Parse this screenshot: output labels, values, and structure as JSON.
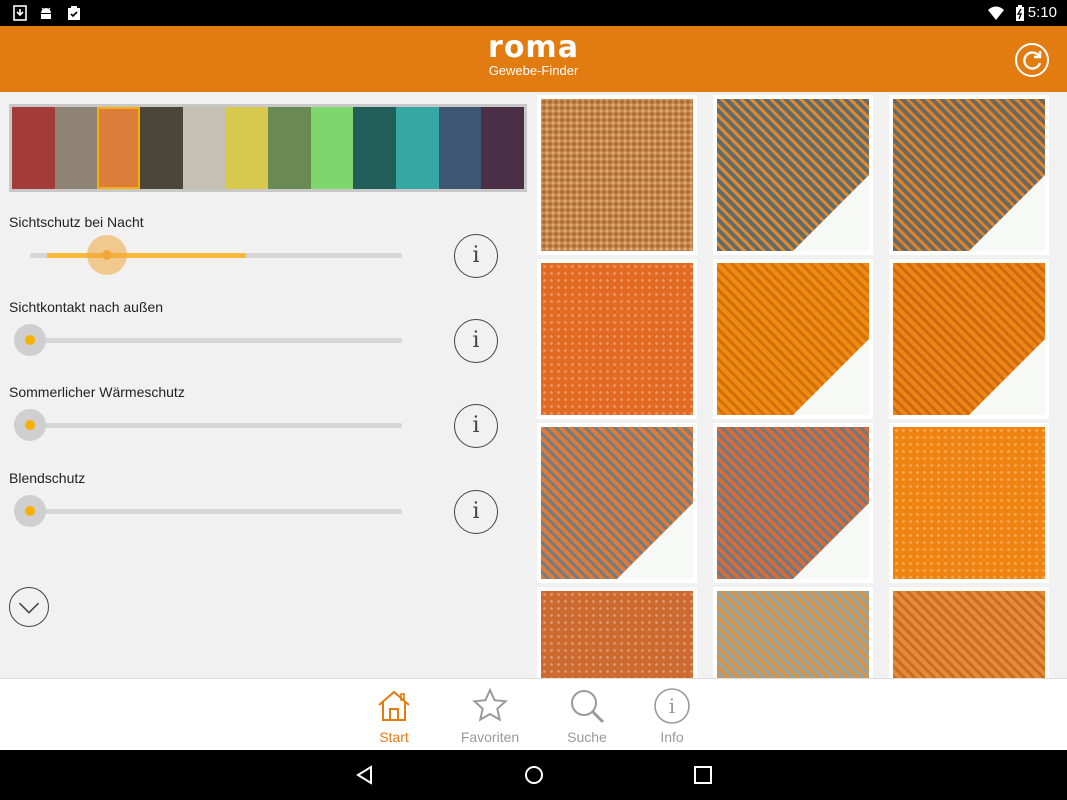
{
  "status_bar": {
    "time": "5:10",
    "left_icons": [
      "download-icon",
      "android-icon",
      "clipboard-check-icon"
    ],
    "right_icons": [
      "wifi-icon",
      "battery-charging-icon"
    ]
  },
  "app_bar": {
    "brand": "roma",
    "subtitle": "Gewebe-Finder",
    "refresh_icon": "refresh-icon",
    "background": "#e27c10"
  },
  "color_palette": [
    {
      "color": "#a23b3a"
    },
    {
      "color": "#8f8474"
    },
    {
      "color": "#dc7d3c",
      "selected": true
    },
    {
      "color": "#4a4638"
    },
    {
      "color": "#c4c1b2"
    },
    {
      "color": "#d6c94e"
    },
    {
      "color": "#6a8a53"
    },
    {
      "color": "#7fd66c"
    },
    {
      "color": "#215e5a"
    },
    {
      "color": "#35a8a3"
    },
    {
      "color": "#3d5674"
    },
    {
      "color": "#4a2f46"
    }
  ],
  "sliders": [
    {
      "label": "Sichtschutz bei Nacht",
      "value": 0.58,
      "active": true
    },
    {
      "label": "Sichtkontakt nach außen",
      "value": 0.0,
      "active": false
    },
    {
      "label": "Sommerlicher Wärmeschutz",
      "value": 0.0,
      "active": false
    },
    {
      "label": "Blendschutz",
      "value": 0.0,
      "active": false
    }
  ],
  "info_button_label": "i",
  "expand_icon": "chevron-down-icon",
  "fabrics": [
    {
      "base": "#c98a4e",
      "accent": "#a86a34",
      "pattern": "boucle",
      "fold": false
    },
    {
      "base": "#5f6b6c",
      "accent": "#e08a2c",
      "pattern": "diag",
      "fold": true
    },
    {
      "base": "#6a6a62",
      "accent": "#e08228",
      "pattern": "diag",
      "fold": true
    },
    {
      "base": "#e26a22",
      "accent": "#c9551a",
      "pattern": "dots",
      "fold": false
    },
    {
      "base": "#f08a12",
      "accent": "#d2700c",
      "pattern": "diag",
      "fold": true
    },
    {
      "base": "#ee8416",
      "accent": "#cc6a10",
      "pattern": "diag",
      "fold": true
    },
    {
      "base": "#e07a3a",
      "accent": "#6e7e82",
      "pattern": "diag",
      "fold": true
    },
    {
      "base": "#d86a3e",
      "accent": "#6a7c7e",
      "pattern": "diag",
      "fold": true
    },
    {
      "base": "#f08412",
      "accent": "#d06a0c",
      "pattern": "dots",
      "fold": false
    },
    {
      "base": "#cc6a30",
      "accent": "#b0561e",
      "pattern": "dots",
      "fold": false
    },
    {
      "base": "#9aa49a",
      "accent": "#e0903a",
      "pattern": "diag",
      "fold": false
    },
    {
      "base": "#e68a3a",
      "accent": "#c86e20",
      "pattern": "diag",
      "fold": false
    }
  ],
  "bottom_nav": [
    {
      "label": "Start",
      "icon": "home-icon",
      "active": true
    },
    {
      "label": "Favoriten",
      "icon": "star-icon",
      "active": false
    },
    {
      "label": "Suche",
      "icon": "search-icon",
      "active": false
    },
    {
      "label": "Info",
      "icon": "info-icon",
      "active": false
    }
  ],
  "system_nav": [
    "back-icon",
    "home-circle-icon",
    "recents-icon"
  ]
}
